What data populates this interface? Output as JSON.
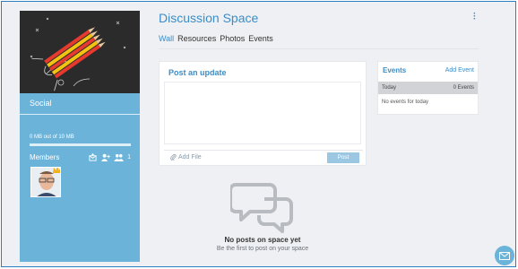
{
  "space": {
    "title": "Discussion Space",
    "group_type": "Social",
    "storage_text": "0 MB out of 10 MB",
    "storage_used_fraction": 0,
    "members_label": "Members",
    "member_count": "1",
    "accent_color": "#3c8dc6",
    "sidebar_color": "#6bb3d9"
  },
  "tabs": [
    {
      "label": "Wall",
      "active": true
    },
    {
      "label": "Resources",
      "active": false
    },
    {
      "label": "Photos",
      "active": false
    },
    {
      "label": "Events",
      "active": false
    }
  ],
  "post": {
    "title": "Post an update",
    "add_file_label": "Add File",
    "post_button_label": "Post"
  },
  "events": {
    "title": "Events",
    "add_event_label": "Add Event",
    "today_label": "Today",
    "today_count": "0 Events",
    "empty_text": "No events for today"
  },
  "empty_state": {
    "title": "No posts on space yet",
    "subtitle": "Be the first to post on your space"
  },
  "icons": {
    "menu": "kebab-menu-icon",
    "paperclip": "paperclip-icon",
    "chat": "chat-bubbles-icon",
    "mail": "mail-icon",
    "invite": "invite-icon",
    "add_member": "add-member-icon",
    "group": "group-icon",
    "crown": "crown-icon"
  }
}
